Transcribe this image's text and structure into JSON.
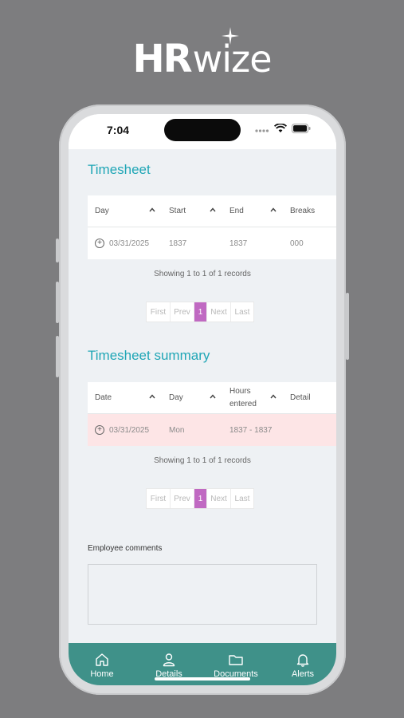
{
  "logo": {
    "hr": "HR",
    "wize": "wize"
  },
  "status": {
    "time": "7:04"
  },
  "timesheet": {
    "title": "Timesheet",
    "headers": [
      "Day",
      "Start",
      "End",
      "Breaks"
    ],
    "rows": [
      {
        "day": "03/31/2025",
        "start": "1837",
        "end": "1837",
        "breaks": "000"
      }
    ],
    "showing": "Showing 1 to 1 of 1 records",
    "pager": {
      "first": "First",
      "prev": "Prev",
      "page": "1",
      "next": "Next",
      "last": "Last"
    }
  },
  "summary": {
    "title": "Timesheet summary",
    "headers": [
      "Date",
      "Day",
      "Hours\nentered",
      "Detail"
    ],
    "header_hours_line1": "Hours",
    "header_hours_line2": "entered",
    "rows": [
      {
        "date": "03/31/2025",
        "day": "Mon",
        "hours": "1837 - 1837",
        "detail": ""
      }
    ],
    "showing": "Showing 1 to 1 of 1 records",
    "pager": {
      "first": "First",
      "prev": "Prev",
      "page": "1",
      "next": "Next",
      "last": "Last"
    }
  },
  "comments": {
    "label": "Employee comments",
    "value": ""
  },
  "nav": {
    "items": [
      {
        "label": "Home",
        "icon": "home-icon"
      },
      {
        "label": "Details",
        "icon": "person-icon"
      },
      {
        "label": "Documents",
        "icon": "folder-icon"
      },
      {
        "label": "Alerts",
        "icon": "bell-icon"
      }
    ]
  },
  "colors": {
    "accent_title": "#20a6b6",
    "nav_bg": "#3f9189",
    "pager_active": "#c069c2",
    "highlight_row": "#fde5e6"
  }
}
